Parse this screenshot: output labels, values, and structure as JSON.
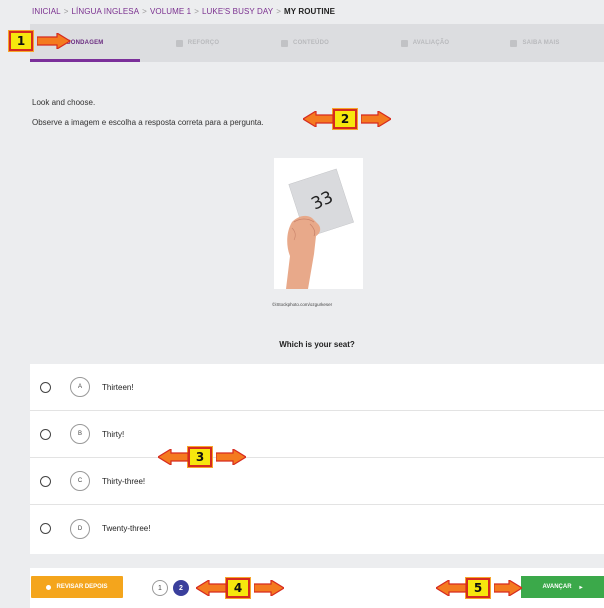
{
  "breadcrumb": {
    "items": [
      "INICIAL",
      "LÍNGUA INGLESA",
      "VOLUME 1",
      "LUKE'S BUSY DAY"
    ],
    "current": "MY ROUTINE",
    "separator": ">"
  },
  "tabs": [
    {
      "label": "SONDAGEM",
      "active": true
    },
    {
      "label": "REFORÇO",
      "active": false
    },
    {
      "label": "CONTEÚDO",
      "active": false
    },
    {
      "label": "AVALIAÇÃO",
      "active": false
    },
    {
      "label": "SAIBA MAIS",
      "active": false
    }
  ],
  "instructions": {
    "en": "Look and choose.",
    "pt": "Observe a imagem e escolha a resposta correta para a pergunta."
  },
  "image": {
    "card_number": "33",
    "credit": "©iStockphoto.com/ozgurkeser"
  },
  "question": "Which is your seat?",
  "options": [
    {
      "letter": "A",
      "text": "Thirteen!"
    },
    {
      "letter": "B",
      "text": "Thirty!"
    },
    {
      "letter": "C",
      "text": "Thirty-three!"
    },
    {
      "letter": "D",
      "text": "Twenty-three!"
    }
  ],
  "footer": {
    "review_later": "REVISAR DEPOIS",
    "pages": [
      "1",
      "2"
    ],
    "current_page": "2",
    "next": "AVANÇAR",
    "next_chevron": "▸"
  },
  "annotations": [
    "1",
    "2",
    "3",
    "4",
    "5"
  ],
  "colors": {
    "accent": "#7b2f9a",
    "later_button": "#f4a51c",
    "next_button": "#3ba94a",
    "page_current": "#3a3f9c",
    "annotation_fill": "#f6e70d",
    "annotation_border": "#d62a1e"
  }
}
